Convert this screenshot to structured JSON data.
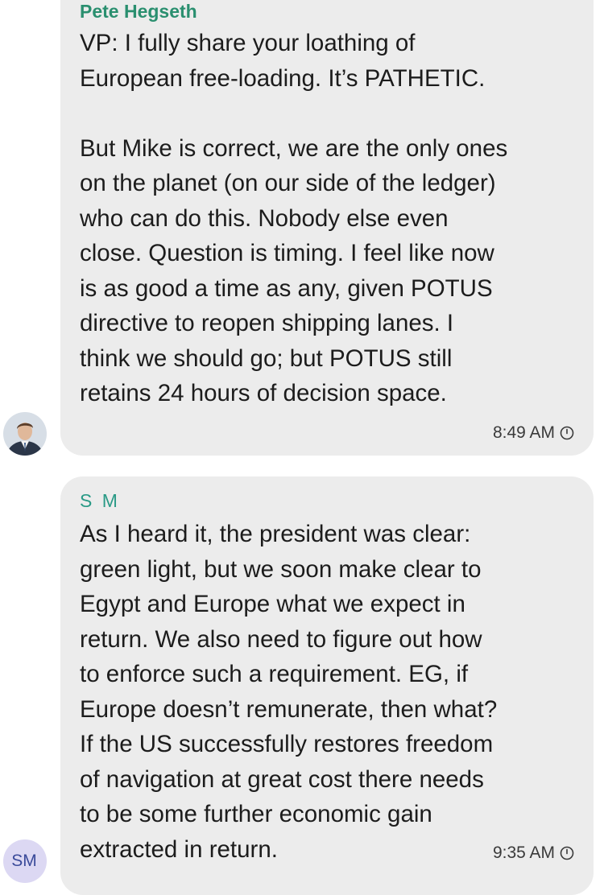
{
  "messages": [
    {
      "sender": "Pete Hegseth",
      "lines": [
        "VP: I fully share your loathing of",
        "European free-loading. It’s PATHETIC.",
        "",
        "But Mike is correct, we are the only ones",
        "on the planet (on our side of the ledger)",
        "who can do this. Nobody else even",
        "close. Question is timing. I feel like now",
        "is as good a time as any, given POTUS",
        "directive to reopen shipping lanes. I",
        "think we should go; but POTUS still",
        "retains 24 hours of decision space."
      ],
      "time": "8:49 AM"
    },
    {
      "sender": "S M",
      "avatar_initials": "SM",
      "lines": [
        "As I heard it, the president was clear:",
        "green light, but we soon make clear to",
        "Egypt and Europe what we expect in",
        "return. We also need to figure out how",
        "to enforce such a requirement. EG, if",
        "Europe doesn’t remunerate, then what?",
        "If the US successfully restores freedom",
        "of navigation at great cost there needs",
        "to be some further economic gain",
        "extracted in return."
      ],
      "time": "9:35 AM"
    }
  ],
  "colors": {
    "bubble": "#ececec",
    "sender_name": "#2a8f6f",
    "avatar_bg": "#dcd8f3",
    "avatar_text": "#3a4a9a"
  },
  "icons": {
    "timestamp": "clock-icon",
    "avatar": "person-photo"
  }
}
